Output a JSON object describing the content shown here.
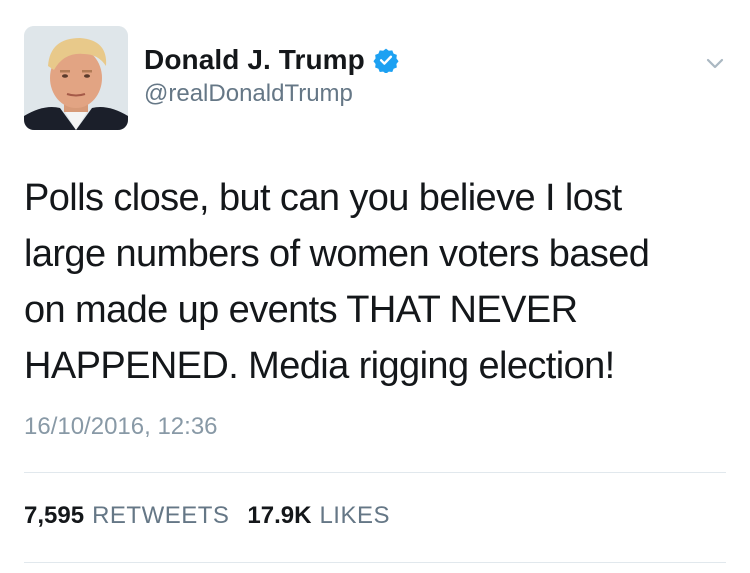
{
  "author": {
    "display_name": "Donald J. Trump",
    "handle": "@realDonaldTrump",
    "verified": true,
    "verified_icon": "verified-badge-icon",
    "avatar": "profile-photo"
  },
  "menu": {
    "icon": "chevron-down-icon"
  },
  "tweet": {
    "text": "Polls close, but can you believe I lost\nlarge numbers of women voters based\non made up events THAT NEVER\nHAPPENED. Media rigging election!",
    "timestamp": "16/10/2016, 12:36"
  },
  "stats": {
    "retweets_count": "7,595",
    "retweets_label": "RETWEETS",
    "likes_count": "17.9K",
    "likes_label": "LIKES"
  },
  "colors": {
    "text": "#14171a",
    "secondary": "#657786",
    "timestamp": "#8899a6",
    "verified": "#1da1f2",
    "divider": "#e1e8ed"
  }
}
